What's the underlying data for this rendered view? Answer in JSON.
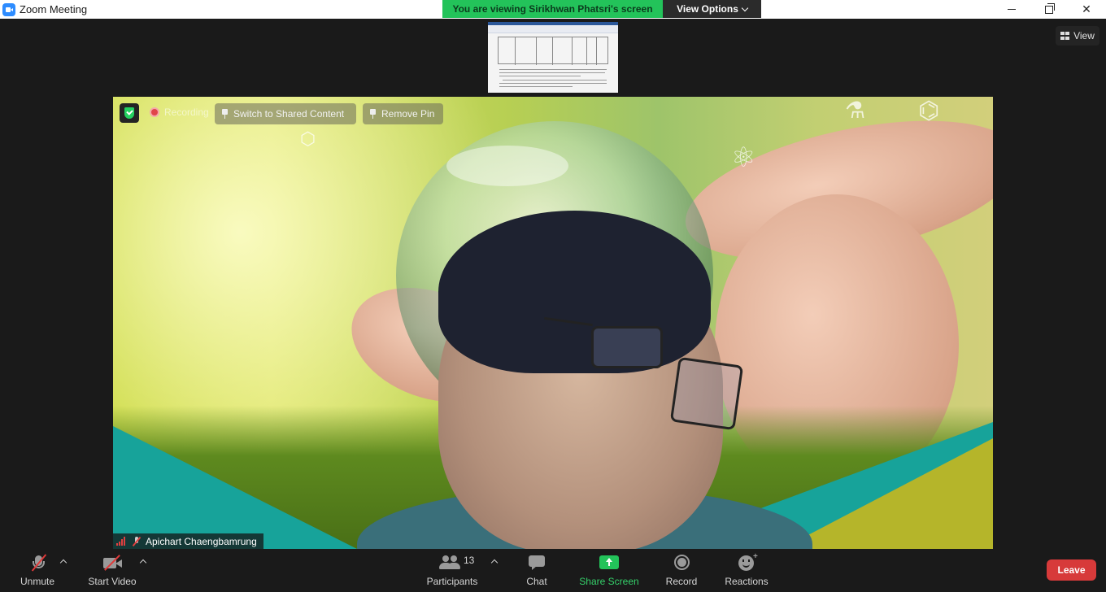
{
  "window": {
    "title": "Zoom Meeting"
  },
  "banner": {
    "viewing_text": "You are viewing Sirikhwan Phatsri's screen",
    "view_options_label": "View Options"
  },
  "view_button": {
    "label": "View"
  },
  "overlay": {
    "recording_label": "Recording",
    "switch_label": "Switch to Shared Content",
    "remove_pin_label": "Remove Pin"
  },
  "participant": {
    "name": "Apichart Chaengbamrung"
  },
  "toolbar": {
    "unmute_label": "Unmute",
    "start_video_label": "Start Video",
    "participants_label": "Participants",
    "participants_count": "13",
    "chat_label": "Chat",
    "share_screen_label": "Share Screen",
    "record_label": "Record",
    "reactions_label": "Reactions",
    "leave_label": "Leave"
  },
  "colors": {
    "banner_green": "#23c35a",
    "leave_red": "#d73a3a",
    "share_green": "#23c35a",
    "background": "#1a1a1a"
  }
}
